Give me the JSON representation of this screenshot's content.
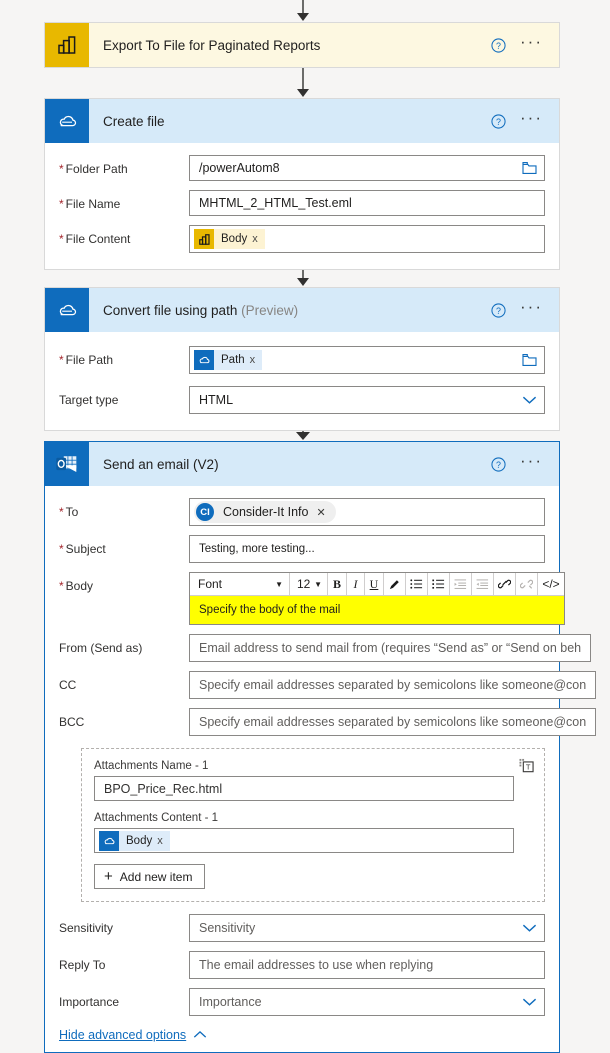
{
  "theme": {
    "page_bg": "#f6f5f4",
    "accent_blue": "#0f6cbd",
    "powerbi_yellow": "#e8b800",
    "powerbi_header_bg": "#fdf8e1",
    "blue_header_bg": "#d6eaf9",
    "required_red": "#a4262c",
    "body_highlight": "#ffff00"
  },
  "steps": [
    {
      "id": "export-to-file",
      "title": "Export To File for Paginated Reports",
      "icon": "power-bi-icon",
      "help_label": "?",
      "more_label": "···"
    },
    {
      "id": "create-file",
      "title": "Create file",
      "icon": "onedrive-icon",
      "help_label": "?",
      "more_label": "···",
      "fields": [
        {
          "label": "Folder Path",
          "required": true,
          "value": "/powerAutom8",
          "trailing_icon": "folder-picker-icon"
        },
        {
          "label": "File Name",
          "required": true,
          "value": "MHTML_2_HTML_Test.eml"
        },
        {
          "label": "File Content",
          "required": true,
          "token": {
            "text": "Body",
            "icon": "power-bi-icon",
            "remove_label": "x"
          }
        }
      ]
    },
    {
      "id": "convert-file-using-path",
      "title": "Convert file using path",
      "title_suffix": "(Preview)",
      "icon": "onedrive-icon",
      "help_label": "?",
      "more_label": "···",
      "fields": [
        {
          "label": "File Path",
          "required": true,
          "token": {
            "text": "Path",
            "icon": "onedrive-icon",
            "remove_label": "x"
          },
          "trailing_icon": "folder-picker-icon"
        },
        {
          "label": "Target type",
          "required": false,
          "value": "HTML",
          "trailing_icon": "chevron-down-icon"
        }
      ]
    },
    {
      "id": "send-an-email-v2",
      "title": "Send an email (V2)",
      "icon": "outlook-icon",
      "help_label": "?",
      "more_label": "···"
    }
  ],
  "email": {
    "to": {
      "label": "To",
      "required": true,
      "chip": {
        "initials": "CI",
        "name": "Consider-It Info",
        "remove_label": "✕"
      }
    },
    "subject": {
      "label": "Subject",
      "required": true,
      "value": "Testing, more testing..."
    },
    "body": {
      "label": "Body",
      "required": true,
      "placeholder": "Specify the body of the mail",
      "toolbar": {
        "font_name": "Font",
        "font_size": "12",
        "bold": "B",
        "italic": "I",
        "underline": "U",
        "text_color": "pen-icon",
        "numbered_list": "numbered-list-icon",
        "bullet_list": "bullet-list-icon",
        "indent": "indent-icon",
        "outdent": "outdent-icon",
        "link": "link-icon",
        "unlink": "unlink-icon",
        "code_view": "</>"
      }
    },
    "from": {
      "label": "From (Send as)",
      "required": false,
      "placeholder": "Email address to send mail from (requires “Send as” or “Send on beh"
    },
    "cc": {
      "label": "CC",
      "required": false,
      "placeholder": "Specify email addresses separated by semicolons like someone@con"
    },
    "bcc": {
      "label": "BCC",
      "required": false,
      "placeholder": "Specify email addresses separated by semicolons like someone@con"
    },
    "attachments": {
      "name_label": "Attachments Name - 1",
      "name_value": "BPO_Price_Rec.html",
      "content_label": "Attachments Content - 1",
      "content_token": {
        "text": "Body",
        "icon": "onedrive-icon",
        "remove_label": "x"
      },
      "add_new_item_label": "Add new item",
      "dynamic_content_icon": "dynamic-content-icon"
    },
    "sensitivity": {
      "label": "Sensitivity",
      "placeholder": "Sensitivity",
      "trailing_icon": "chevron-down-icon"
    },
    "reply_to": {
      "label": "Reply To",
      "placeholder": "The email addresses to use when replying"
    },
    "importance": {
      "label": "Importance",
      "placeholder": "Importance",
      "trailing_icon": "chevron-down-icon"
    },
    "hide_advanced_label": "Hide advanced options"
  }
}
